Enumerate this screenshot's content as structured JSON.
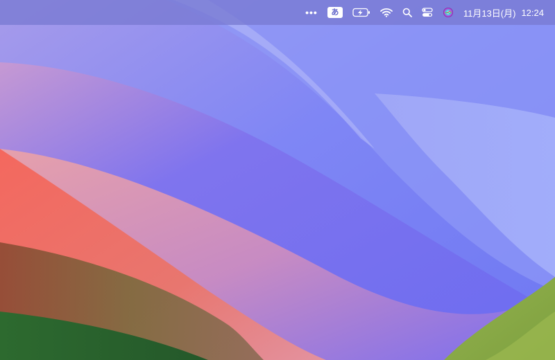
{
  "wallpaper": {
    "name": "macOS Sonoma",
    "colors": {
      "sky_top": "#8c8ef2",
      "sky_blue": "#6d74f0",
      "pale_blue": "#9ea8f8",
      "coral": "#f26f67",
      "pink": "#e79ab0",
      "olive": "#7a6a3e",
      "green": "#2e6a2f",
      "lime": "#8cab47"
    }
  },
  "menubar": {
    "items": [
      {
        "name": "more-menu-extras-icon",
        "glyph": "•••"
      },
      {
        "name": "input-method-icon",
        "label": "あ"
      },
      {
        "name": "battery-charging-icon"
      },
      {
        "name": "wifi-icon"
      },
      {
        "name": "spotlight-search-icon"
      },
      {
        "name": "control-center-icon"
      },
      {
        "name": "siri-icon"
      }
    ],
    "date": "11月13日(月)",
    "time": "12:24"
  }
}
